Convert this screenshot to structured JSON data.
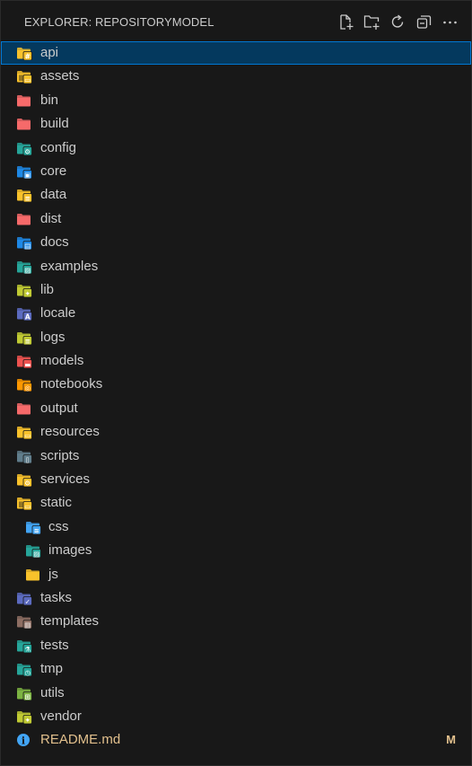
{
  "explorer": {
    "title": "EXPLORER: REPOSITORYMODEL",
    "actions": [
      {
        "name": "new-file-button",
        "icon": "new-file-icon"
      },
      {
        "name": "new-folder-button",
        "icon": "new-folder-icon"
      },
      {
        "name": "refresh-button",
        "icon": "refresh-icon"
      },
      {
        "name": "collapse-all-button",
        "icon": "collapse-all-icon"
      },
      {
        "name": "more-actions-button",
        "icon": "ellipsis-icon"
      }
    ]
  },
  "tree": [
    {
      "label": "api",
      "depth": 0,
      "color": "#f9c22b",
      "glyph": "#",
      "selected": true
    },
    {
      "label": "assets",
      "depth": 0,
      "color": "#f9c22b",
      "glyph": "▭",
      "open": true
    },
    {
      "label": "bin",
      "depth": 0,
      "color": "#f66a6a",
      "glyph": ""
    },
    {
      "label": "build",
      "depth": 0,
      "color": "#f66a6a",
      "glyph": ""
    },
    {
      "label": "config",
      "depth": 0,
      "color": "#26a69a",
      "glyph": "⚙"
    },
    {
      "label": "core",
      "depth": 0,
      "color": "#1e88e5",
      "glyph": "▣"
    },
    {
      "label": "data",
      "depth": 0,
      "color": "#f9c22b",
      "glyph": "≡"
    },
    {
      "label": "dist",
      "depth": 0,
      "color": "#f66a6a",
      "glyph": ""
    },
    {
      "label": "docs",
      "depth": 0,
      "color": "#1e88e5",
      "glyph": "▤"
    },
    {
      "label": "examples",
      "depth": 0,
      "color": "#26a69a",
      "glyph": "▨"
    },
    {
      "label": "lib",
      "depth": 0,
      "color": "#c0ca33",
      "glyph": "✦"
    },
    {
      "label": "locale",
      "depth": 0,
      "color": "#5c6bc0",
      "glyph": "A"
    },
    {
      "label": "logs",
      "depth": 0,
      "color": "#c0ca33",
      "glyph": "≡"
    },
    {
      "label": "models",
      "depth": 0,
      "color": "#ef5350",
      "glyph": "▬"
    },
    {
      "label": "notebooks",
      "depth": 0,
      "color": "#ff9800",
      "glyph": "◎"
    },
    {
      "label": "output",
      "depth": 0,
      "color": "#f66a6a",
      "glyph": ""
    },
    {
      "label": "resources",
      "depth": 0,
      "color": "#f9c22b",
      "glyph": "▭"
    },
    {
      "label": "scripts",
      "depth": 0,
      "color": "#607d8b",
      "glyph": "▯"
    },
    {
      "label": "services",
      "depth": 0,
      "color": "#f9c22b",
      "glyph": "⚙"
    },
    {
      "label": "static",
      "depth": 0,
      "color": "#f9c22b",
      "glyph": "▭",
      "open": true
    },
    {
      "label": "css",
      "depth": 1,
      "color": "#42a5f5",
      "glyph": "≋"
    },
    {
      "label": "images",
      "depth": 1,
      "color": "#26a69a",
      "glyph": "▨"
    },
    {
      "label": "js",
      "depth": 1,
      "color": "#f9c22b",
      "glyph": ""
    },
    {
      "label": "tasks",
      "depth": 0,
      "color": "#5c6bc0",
      "glyph": "✓"
    },
    {
      "label": "templates",
      "depth": 0,
      "color": "#8d6e63",
      "glyph": "▥"
    },
    {
      "label": "tests",
      "depth": 0,
      "color": "#26a69a",
      "glyph": "⚗"
    },
    {
      "label": "tmp",
      "depth": 0,
      "color": "#26a69a",
      "glyph": "◷"
    },
    {
      "label": "utils",
      "depth": 0,
      "color": "#7cb342",
      "glyph": "⊞"
    },
    {
      "label": "vendor",
      "depth": 0,
      "color": "#c0ca33",
      "glyph": "✦"
    },
    {
      "label": "README.md",
      "depth": 0,
      "type": "file",
      "color": "#42a5f5",
      "glyph": "i",
      "badge": "M",
      "modified": true
    }
  ]
}
